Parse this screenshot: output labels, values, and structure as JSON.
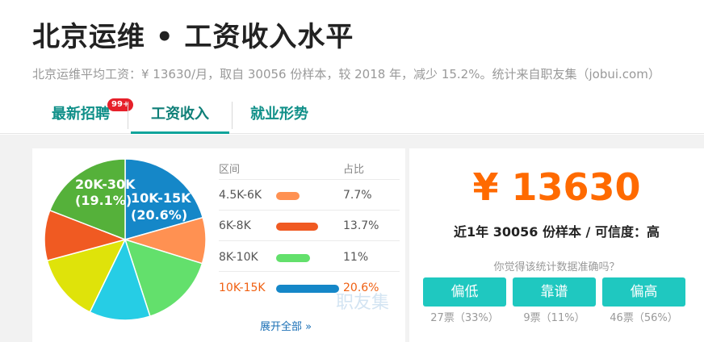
{
  "page": {
    "title": "北京运维 • 工资收入水平",
    "summary": "北京运维平均工资：¥ 13630/月，取自 30056 份样本，较 2018 年，减少 15.2%。统计来自职友集（jobui.com）"
  },
  "tabs": [
    {
      "label": "最新招聘",
      "badge": "99+"
    },
    {
      "label": "工资收入",
      "active": true
    },
    {
      "label": "就业形势"
    }
  ],
  "chart_data": {
    "type": "pie",
    "slices": [
      {
        "label": "10K-15K",
        "value": 20.6,
        "color": "#1587c8"
      },
      {
        "label": "",
        "value": 9.2,
        "color": "#ff9152"
      },
      {
        "label": "",
        "value": 15.2,
        "color": "#63e06c"
      },
      {
        "label": "",
        "value": 12.2,
        "color": "#26cde5"
      },
      {
        "label": "",
        "value": 13.6,
        "color": "#dfe30a"
      },
      {
        "label": "",
        "value": 10.1,
        "color": "#f05a22"
      },
      {
        "label": "20K-30K",
        "value": 19.1,
        "color": "#55b13a"
      }
    ],
    "labels_shown": [
      {
        "range": "20K-30K",
        "pct": "(19.1%)"
      },
      {
        "range": "10K-15K",
        "pct": "(20.6%)"
      }
    ]
  },
  "table": {
    "headers": {
      "range": "区间",
      "ratio": "占比"
    },
    "rows": [
      {
        "range": "4.5K-6K",
        "pct": "7.7%",
        "value": 7.7,
        "color": "#ff9152"
      },
      {
        "range": "6K-8K",
        "pct": "13.7%",
        "value": 13.7,
        "color": "#f05a22"
      },
      {
        "range": "8K-10K",
        "pct": "11%",
        "value": 11,
        "color": "#63e06c"
      },
      {
        "range": "10K-15K",
        "pct": "20.6%",
        "value": 20.6,
        "color": "#1587c8",
        "highlight": true
      }
    ],
    "expand_label": "展开全部 »"
  },
  "watermark": "职友集",
  "stats": {
    "salary": "¥ 13630",
    "sample_text": "近1年 30056 份样本 / 可信度：高",
    "question": "你觉得该统计数据准确吗？",
    "votes": [
      {
        "label": "偏低",
        "count": "27票（33%）"
      },
      {
        "label": "靠谱",
        "count": "9票（11%）"
      },
      {
        "label": "偏高",
        "count": "46票（56%）"
      }
    ]
  }
}
